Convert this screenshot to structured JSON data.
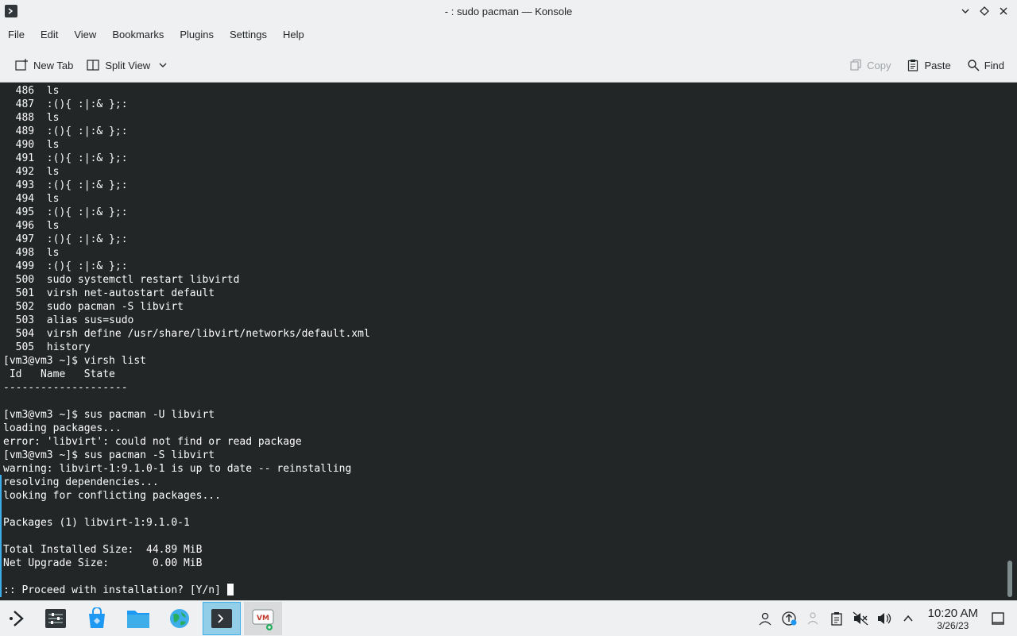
{
  "window": {
    "title": "- : sudo pacman — Konsole"
  },
  "menu": {
    "items": [
      "File",
      "Edit",
      "View",
      "Bookmarks",
      "Plugins",
      "Settings",
      "Help"
    ]
  },
  "toolbar": {
    "new_tab": "New Tab",
    "split_view": "Split View",
    "copy": "Copy",
    "paste": "Paste",
    "find": "Find"
  },
  "terminal": {
    "lines": [
      "  486  ls",
      "  487  :(){ :|:& };:",
      "  488  ls",
      "  489  :(){ :|:& };:",
      "  490  ls",
      "  491  :(){ :|:& };:",
      "  492  ls",
      "  493  :(){ :|:& };:",
      "  494  ls",
      "  495  :(){ :|:& };:",
      "  496  ls",
      "  497  :(){ :|:& };:",
      "  498  ls",
      "  499  :(){ :|:& };:",
      "  500  sudo systemctl restart libvirtd",
      "  501  virsh net-autostart default",
      "  502  sudo pacman -S libvirt",
      "  503  alias sus=sudo",
      "  504  virsh define /usr/share/libvirt/networks/default.xml",
      "  505  history",
      "[vm3@vm3 ~]$ virsh list",
      " Id   Name   State",
      "--------------------",
      "",
      "[vm3@vm3 ~]$ sus pacman -U libvirt",
      "loading packages...",
      "error: 'libvirt': could not find or read package",
      "[vm3@vm3 ~]$ sus pacman -S libvirt",
      "warning: libvirt-1:9.1.0-1 is up to date -- reinstalling",
      "resolving dependencies...",
      "looking for conflicting packages...",
      "",
      "Packages (1) libvirt-1:9.1.0-1",
      "",
      "Total Installed Size:  44.89 MiB",
      "Net Upgrade Size:       0.00 MiB",
      "",
      ":: Proceed with installation? [Y/n] "
    ]
  },
  "taskbar": {
    "clock_time": "10:20 AM",
    "clock_date": "3/26/23"
  }
}
